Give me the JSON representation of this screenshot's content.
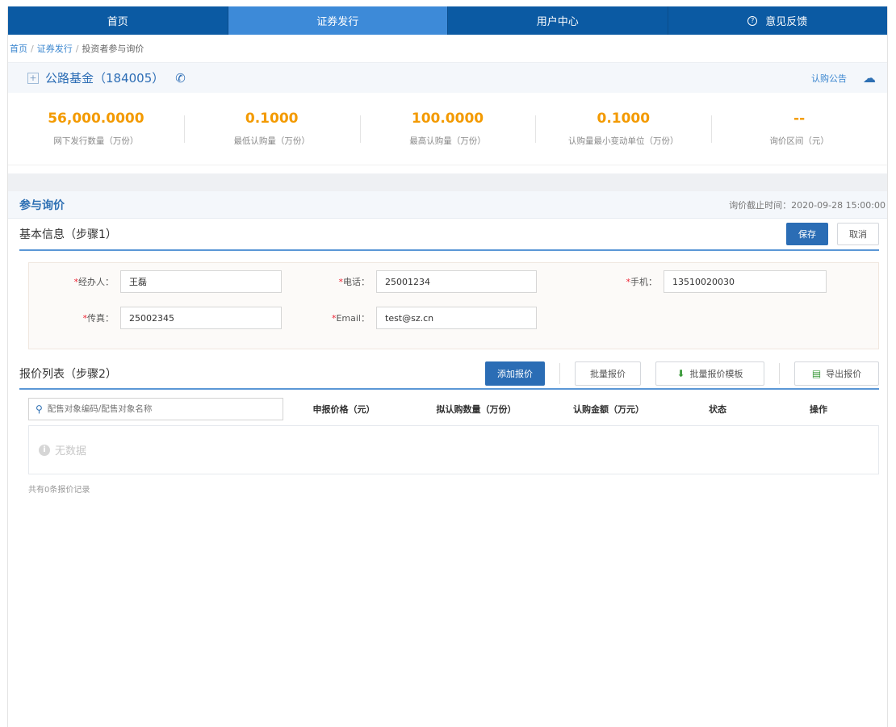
{
  "nav": {
    "items": [
      {
        "label": "首页"
      },
      {
        "label": "证券发行"
      },
      {
        "label": "用户中心"
      },
      {
        "label": "意见反馈"
      }
    ],
    "active_index": 1
  },
  "breadcrumb": {
    "home": "首页",
    "issue": "证券发行",
    "current": "投资者参与询价"
  },
  "fund": {
    "name": "公路基金（184005）",
    "notice_link": "认购公告"
  },
  "stats": [
    {
      "value": "56,000.0000",
      "label": "网下发行数量（万份）"
    },
    {
      "value": "0.1000",
      "label": "最低认购量（万份）"
    },
    {
      "value": "100.0000",
      "label": "最高认购量（万份）"
    },
    {
      "value": "0.1000",
      "label": "认购量最小变动单位（万份）"
    },
    {
      "value": "--",
      "label": "询价区间（元）"
    }
  ],
  "section": {
    "title": "参与询价",
    "deadline": "询价截止时间：2020-09-28 15:00:00"
  },
  "step1": {
    "title": "基本信息（步骤1）",
    "save": "保存",
    "cancel": "取消"
  },
  "form": {
    "contact_label": "经办人：",
    "contact_value": "王磊",
    "phone_label": "电话：",
    "phone_value": "25001234",
    "mobile_label": "手机：",
    "mobile_value": "13510020030",
    "fax_label": "传真：",
    "fax_value": "25002345",
    "email_label": "Email：",
    "email_value": "test@sz.cn"
  },
  "step2": {
    "title": "报价列表（步骤2）",
    "add": "添加报价",
    "batch": "批量报价",
    "template": "批量报价模板",
    "export": "导出报价"
  },
  "table": {
    "search_placeholder": "配售对象编码/配售对象名称",
    "columns": [
      "申报价格（元）",
      "拟认购数量（万份）",
      "认购金额（万元）",
      "状态",
      "操作"
    ],
    "empty": "无数据"
  },
  "footer_note": "共有0条报价记录"
}
